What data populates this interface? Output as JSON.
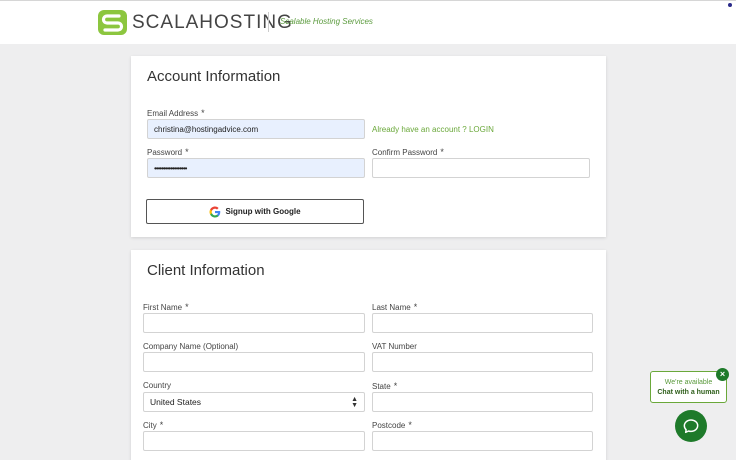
{
  "header": {
    "brand": "SCALAHOSTING",
    "tagline": "Scalable Hosting Services"
  },
  "account": {
    "title": "Account Information",
    "email_label": "Email Address",
    "email_value": "christina@hostingadvice.com",
    "login_link": "Already have an account ? LOGIN",
    "password_label": "Password",
    "password_value": "••••••••••••••••••",
    "confirm_password_label": "Confirm Password",
    "confirm_password_value": "",
    "google_button": "Signup with Google",
    "required_mark": "*"
  },
  "client": {
    "title": "Client Information",
    "first_name_label": "First Name",
    "last_name_label": "Last Name",
    "company_label": "Company Name (Optional)",
    "vat_label": "VAT Number",
    "country_label": "Country",
    "country_value": "United States",
    "state_label": "State",
    "city_label": "City",
    "postcode_label": "Postcode"
  },
  "chat": {
    "line1": "We're available",
    "line2": "Chat with a human",
    "close": "×"
  },
  "colors": {
    "brand_green": "#6aa83a",
    "chat_green": "#1e7a2a",
    "autofill_blue": "#e8f0fe"
  }
}
